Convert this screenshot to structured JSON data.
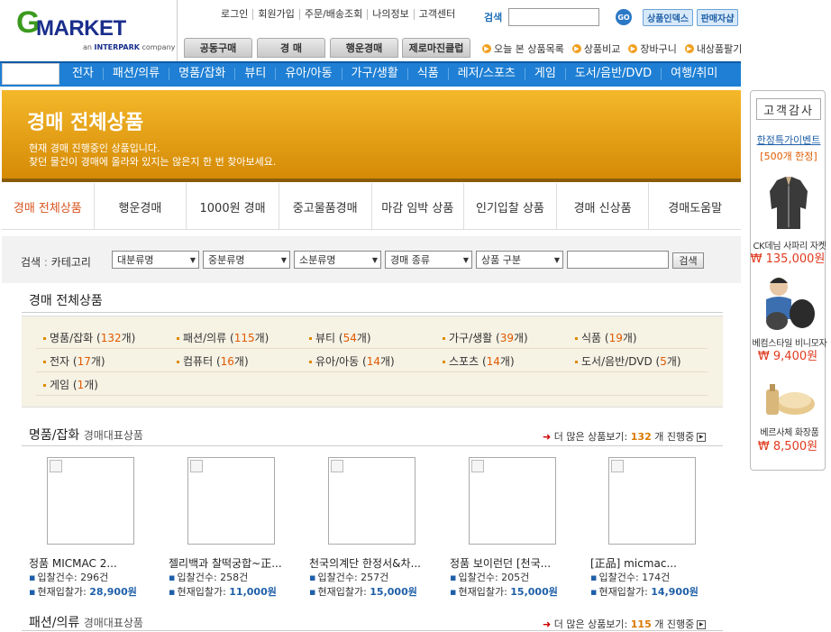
{
  "logo": {
    "brand_g": "G",
    "brand_rest": "MARKET",
    "sub_prefix": "an ",
    "sub_brand": "INTERPARK",
    "sub_suffix": " company"
  },
  "top_links": [
    "로그인",
    "회원가입",
    "주문/배송조회",
    "나의정보",
    "고객센터"
  ],
  "search": {
    "label": "검색",
    "go": "GO"
  },
  "top_buttons": [
    "상품인덱스",
    "판매자샵"
  ],
  "main_tabs": [
    "공동구매",
    "경 매",
    "행운경매",
    "제로마진클럽"
  ],
  "quick_links": [
    "오늘 본 상품목록",
    "상품비교",
    "장바구니",
    "내상품팔기"
  ],
  "categories": [
    "전자",
    "패션/의류",
    "명품/잡화",
    "뷰티",
    "유아/아동",
    "가구/생활",
    "식품",
    "레저/스포츠",
    "게임",
    "도서/음반/DVD",
    "여행/취미"
  ],
  "banner": {
    "title": "경매 전체상품",
    "line1": "현재 경매 진행중인 상품입니다.",
    "line2": "찾던 물건이 경매에 올라와 있지는 않은지 한 번 찾아보세요."
  },
  "sub_tabs": [
    "경매 전체상품",
    "행운경매",
    "1000원 경매",
    "중고물품경매",
    "마감 임박 상품",
    "인기입찰 상품",
    "경매 신상품",
    "경매도움말"
  ],
  "filter": {
    "search_label": "검색",
    "category_label": "카테고리",
    "selects": [
      "대분류명",
      "중분류명",
      "소분류명",
      "경매 종류",
      "상품 구분"
    ],
    "button": "검색"
  },
  "all_section": {
    "title": "경매 전체상품"
  },
  "cat_counts": [
    {
      "name": "명품/잡화",
      "count": "132",
      "unit": "개"
    },
    {
      "name": "패션/의류",
      "count": "115",
      "unit": "개"
    },
    {
      "name": "뷰티",
      "count": "54",
      "unit": "개"
    },
    {
      "name": "가구/생활",
      "count": "39",
      "unit": "개"
    },
    {
      "name": "식품",
      "count": "19",
      "unit": "개"
    },
    {
      "name": "전자",
      "count": "17",
      "unit": "개"
    },
    {
      "name": "컴퓨터",
      "count": "16",
      "unit": "개"
    },
    {
      "name": "유아/아동",
      "count": "14",
      "unit": "개"
    },
    {
      "name": "스포츠",
      "count": "14",
      "unit": "개"
    },
    {
      "name": "도서/음반/DVD",
      "count": "5",
      "unit": "개"
    },
    {
      "name": "게임",
      "count": "1",
      "unit": "개"
    }
  ],
  "section1": {
    "title": "명품/잡화",
    "subtitle": "경매대표상품",
    "more_label": "더 많은 상품보기:",
    "count": "132",
    "suffix": "개 진행중"
  },
  "products": [
    {
      "name": "정품 MICMAC 2...",
      "bid_label": "입찰건수:",
      "bids": "296건",
      "price_label": "현재입찰가:",
      "price": "28,900원"
    },
    {
      "name": "젤리백과 찰떡궁합~正...",
      "bid_label": "입찰건수:",
      "bids": "258건",
      "price_label": "현재입찰가:",
      "price": "11,000원"
    },
    {
      "name": "천국의계단 한정서&차...",
      "bid_label": "입찰건수:",
      "bids": "257건",
      "price_label": "현재입찰가:",
      "price": "15,000원"
    },
    {
      "name": "정품 보이런던 [천국...",
      "bid_label": "입찰건수:",
      "bids": "205건",
      "price_label": "현재입찰가:",
      "price": "15,000원"
    },
    {
      "name": "[正品] micmac...",
      "bid_label": "입찰건수:",
      "bids": "174건",
      "price_label": "현재입찰가:",
      "price": "14,900원"
    }
  ],
  "section2": {
    "title": "패션/의류",
    "subtitle": "경매대표상품",
    "more_label": "더 많은 상품보기:",
    "count": "115",
    "suffix": "개 진행중"
  },
  "side": {
    "header": "고객감사",
    "event": "한정특가이벤트",
    "event_sub": "[500개 한정]",
    "items": [
      {
        "name": "CK데님 사파리 자켓",
        "price": "₩ 135,000원"
      },
      {
        "name": "베컴스타일 비니모자",
        "price": "₩ 9,400원"
      },
      {
        "name": "베르사체 화장품",
        "price": "₩ 8,500원"
      }
    ]
  }
}
